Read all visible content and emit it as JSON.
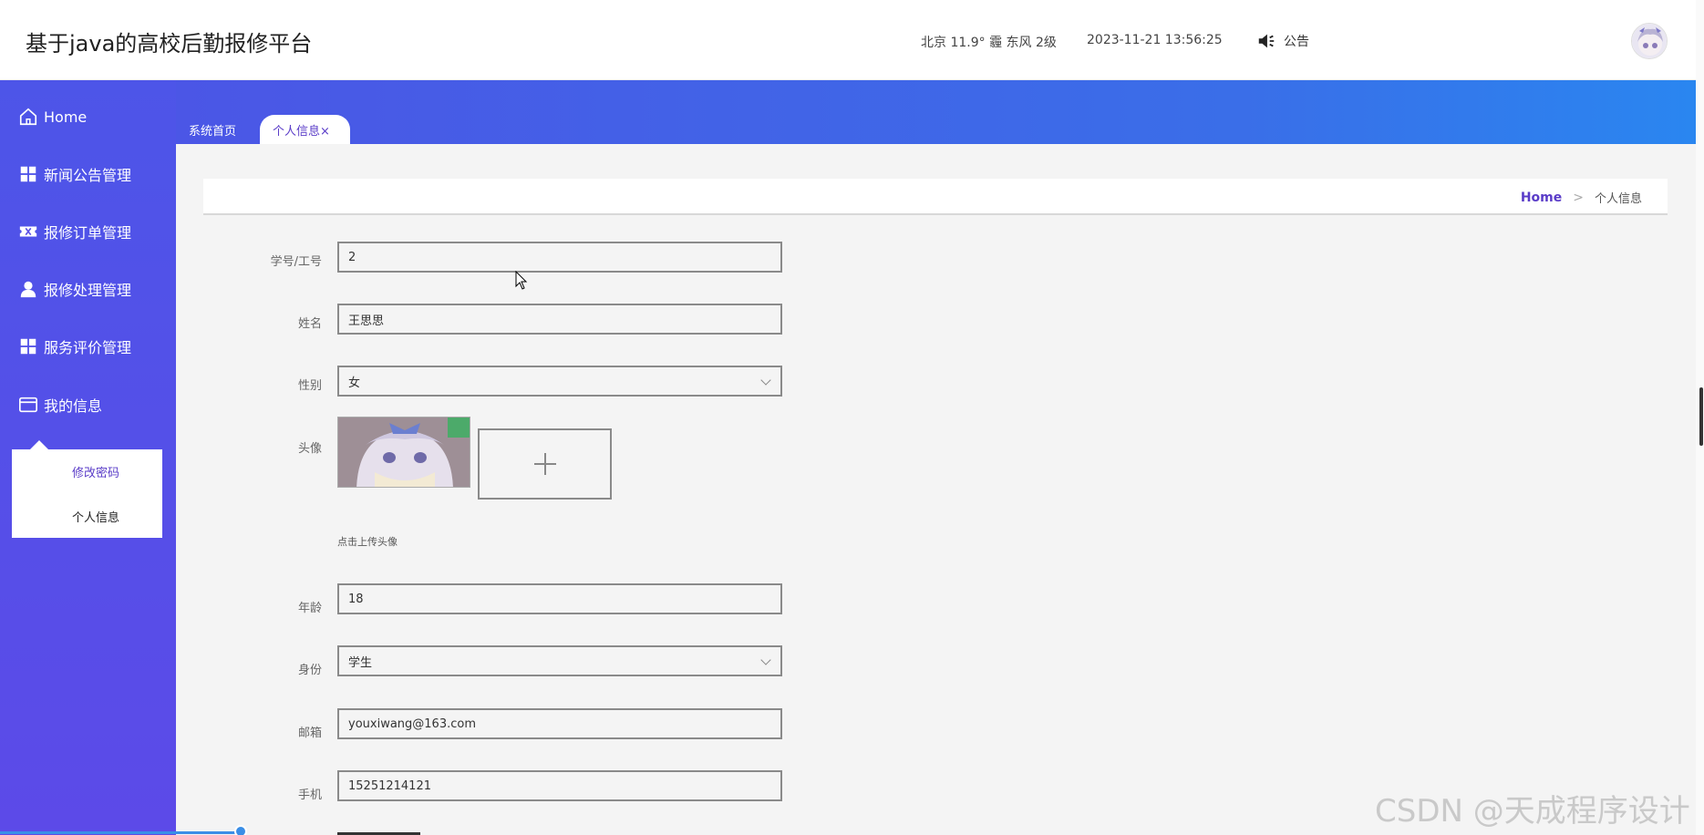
{
  "header": {
    "app_title": "基于java的高校后勤报修平台",
    "weather": "北京  11.9°  霾  东风  2级",
    "datetime": "2023-11-21 13:56:25",
    "notice_label": "公告"
  },
  "sidebar": {
    "items": [
      {
        "label": "Home",
        "icon": "home-icon"
      },
      {
        "label": "新闻公告管理",
        "icon": "grid-icon"
      },
      {
        "label": "报修订单管理",
        "icon": "ticket-icon"
      },
      {
        "label": "报修处理管理",
        "icon": "user-icon"
      },
      {
        "label": "服务评价管理",
        "icon": "grid-icon"
      },
      {
        "label": "我的信息",
        "icon": "card-icon"
      }
    ],
    "submenu": [
      {
        "label": "修改密码"
      },
      {
        "label": "个人信息"
      }
    ]
  },
  "tabs": [
    {
      "label": "系统首页"
    },
    {
      "label": "个人信息×"
    }
  ],
  "breadcrumb": {
    "home": "Home",
    "separator": ">",
    "current": "个人信息"
  },
  "form": {
    "id_label": "学号/工号",
    "id_value": "2",
    "name_label": "姓名",
    "name_value": "王思思",
    "gender_label": "性别",
    "gender_value": "女",
    "avatar_label": "头像",
    "upload_hint": "点击上传头像",
    "age_label": "年龄",
    "age_value": "18",
    "role_label": "身份",
    "role_value": "学生",
    "email_label": "邮箱",
    "email_value": "youxiwang@163.com",
    "phone_label": "手机",
    "phone_value": "15251214121"
  },
  "watermark": "CSDN @天成程序设计",
  "colors": {
    "accent": "#5a3cc8",
    "sidebar_top": "#4d55e8",
    "tab_strip_end": "#2a86f0"
  }
}
